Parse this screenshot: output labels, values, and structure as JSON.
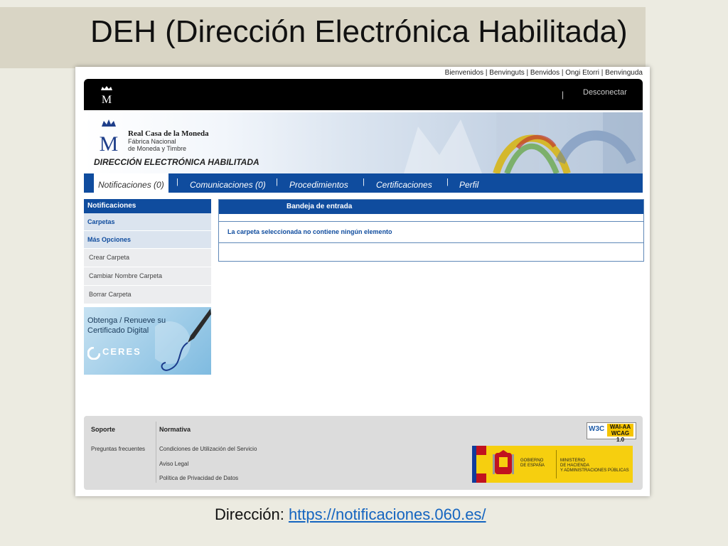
{
  "slide": {
    "title": "DEH (Dirección Electrónica Habilitada)",
    "caption_label": "Dirección:",
    "caption_url": "https://notificaciones.060.es/"
  },
  "site": {
    "languages": "Bienvenidos | Benvinguts | Benvidos | Ongi Etorri | Benvinguda",
    "logout": "Desconectar",
    "org_name": "Real Casa de la Moneda",
    "org_sub1": "Fábrica Nacional",
    "org_sub2": "de Moneda y Timbre",
    "app_title": "DIRECCIÓN ELECTRÓNICA HABILITADA",
    "nav": [
      {
        "label": "Notificaciones (0)"
      },
      {
        "label": "Comunicaciones (0)"
      },
      {
        "label": "Procedimientos"
      },
      {
        "label": "Certificaciones"
      },
      {
        "label": "Perfil"
      }
    ],
    "sidebar": {
      "title": "Notificaciones",
      "folders": "Carpetas",
      "more": "Más Opciones",
      "items": [
        "Crear Carpeta",
        "Cambiar Nombre Carpeta",
        "Borrar Carpeta"
      ]
    },
    "ceres": {
      "line1": "Obtenga / Renueve su",
      "line2": "Certificado Digital",
      "logo": "CERES"
    },
    "inbox": {
      "title": "Bandeja de entrada",
      "empty_msg": "La carpeta seleccionada no contiene ningún elemento"
    },
    "footer": {
      "support": "Soporte",
      "faq": "Preguntas frecuentes",
      "normativa": "Normativa",
      "links": [
        "Condiciones de Utilización del Servicio",
        "Aviso Legal",
        "Política de Privacidad de Datos"
      ],
      "w3c": "W3C",
      "wai1": "WAI-AA",
      "wai2": "WCAG 1.0",
      "gov1": "GOBIERNO",
      "gov2": "DE ESPAÑA",
      "min1": "MINISTERIO",
      "min2": "DE HACIENDA",
      "min3": "Y ADMINISTRACIONES PÚBLICAS"
    }
  },
  "colors": {
    "nav": "#0f4c9e",
    "link": "#1565c0",
    "slide_bg": "#ecebe1"
  }
}
